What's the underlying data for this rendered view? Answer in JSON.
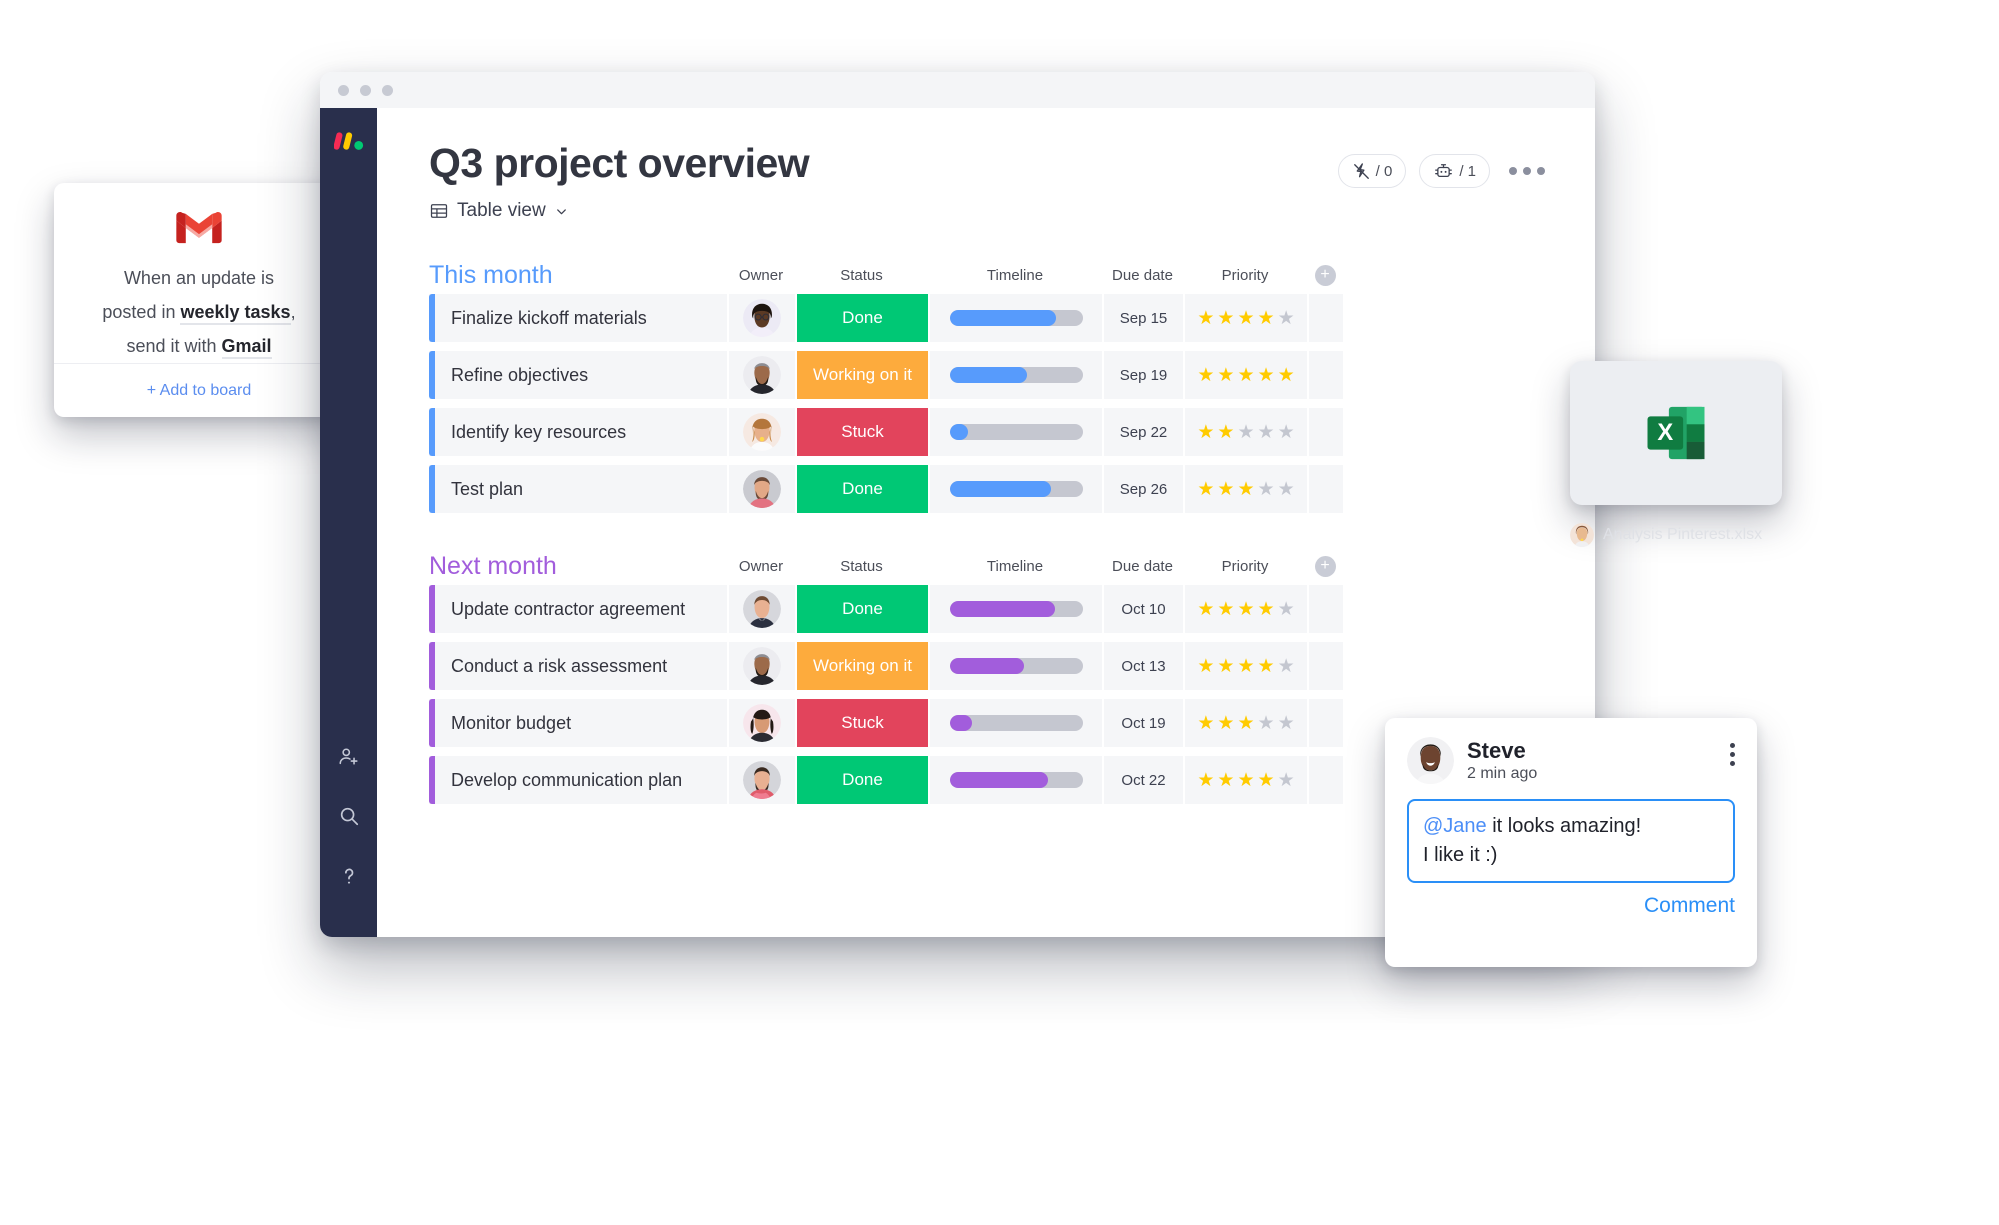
{
  "gmail_card": {
    "icon": "gmail-icon",
    "line1": "When an update is",
    "line2_pre": "posted in ",
    "line2_bold": "weekly tasks",
    "line2_post": ",",
    "line3_pre": "send it with ",
    "line3_bold": "Gmail",
    "add_label": "+ Add to board"
  },
  "window": {
    "traffic_dots": 3,
    "sidebar": {
      "logo": "monday-logo-icon",
      "items": [
        {
          "name": "invite-member-icon"
        },
        {
          "name": "search-icon"
        },
        {
          "name": "help-icon"
        }
      ]
    }
  },
  "header": {
    "title": "Q3 project overview",
    "view_label": "Table view",
    "view_icon": "table-icon",
    "integrations": {
      "icon": "integration-icon",
      "count": "/ 0"
    },
    "automations": {
      "icon": "automation-robot-icon",
      "count": "/ 1"
    },
    "more_menu": "more-options-icon"
  },
  "columns": [
    "Owner",
    "Status",
    "Timeline",
    "Due date",
    "Priority"
  ],
  "colors": {
    "group_this_month": "#579bfc",
    "group_next_month": "#a25ddc",
    "status_done": "#00c875",
    "status_working": "#fdab3d",
    "status_stuck": "#e2445c",
    "star_on": "#ffcb00",
    "star_off": "#c4c7d0",
    "sidebar_bg": "#292f4c"
  },
  "groups": [
    {
      "title": "This month",
      "accent": "#579bfc",
      "rows": [
        {
          "name": "Finalize kickoff materials",
          "owner": "avatar-woman-glasses",
          "status": "Done",
          "status_color": "#00c875",
          "progress": 80,
          "due": "Sep 15",
          "priority": 4
        },
        {
          "name": "Refine objectives",
          "owner": "avatar-man-beard",
          "status": "Working on it",
          "status_color": "#fdab3d",
          "progress": 58,
          "due": "Sep 19",
          "priority": 5
        },
        {
          "name": "Identify key resources",
          "owner": "avatar-woman-blonde",
          "status": "Stuck",
          "status_color": "#e2445c",
          "progress": 14,
          "due": "Sep 22",
          "priority": 2
        },
        {
          "name": "Test plan",
          "owner": "avatar-man-gray",
          "status": "Done",
          "status_color": "#00c875",
          "progress": 76,
          "due": "Sep 26",
          "priority": 3
        }
      ]
    },
    {
      "title": "Next month",
      "accent": "#a25ddc",
      "rows": [
        {
          "name": "Update contractor agreement",
          "owner": "avatar-man-short-hair",
          "status": "Done",
          "status_color": "#00c875",
          "progress": 79,
          "due": "Oct 10",
          "priority": 4
        },
        {
          "name": "Conduct a risk assessment",
          "owner": "avatar-man-beard",
          "status": "Working on it",
          "status_color": "#fdab3d",
          "progress": 56,
          "due": "Oct 13",
          "priority": 4
        },
        {
          "name": "Monitor budget",
          "owner": "avatar-woman-dark",
          "status": "Stuck",
          "status_color": "#e2445c",
          "progress": 17,
          "due": "Oct 19",
          "priority": 3
        },
        {
          "name": "Develop communication plan",
          "owner": "avatar-man-curly",
          "status": "Done",
          "status_color": "#00c875",
          "progress": 74,
          "due": "Oct 22",
          "priority": 4
        }
      ]
    }
  ],
  "excel_card": {
    "icon": "excel-file-icon",
    "filename": "Analysis Pinterest.xlsx",
    "uploader_avatar": "avatar-woman-blonde"
  },
  "comment": {
    "author": "Steve",
    "avatar": "avatar-steve",
    "timestamp": "2 min ago",
    "mention": "@Jane",
    "text_rest": " it looks amazing!",
    "text_line2": "I like it :)",
    "submit_label": "Comment",
    "menu_icon": "kebab-menu-icon"
  }
}
